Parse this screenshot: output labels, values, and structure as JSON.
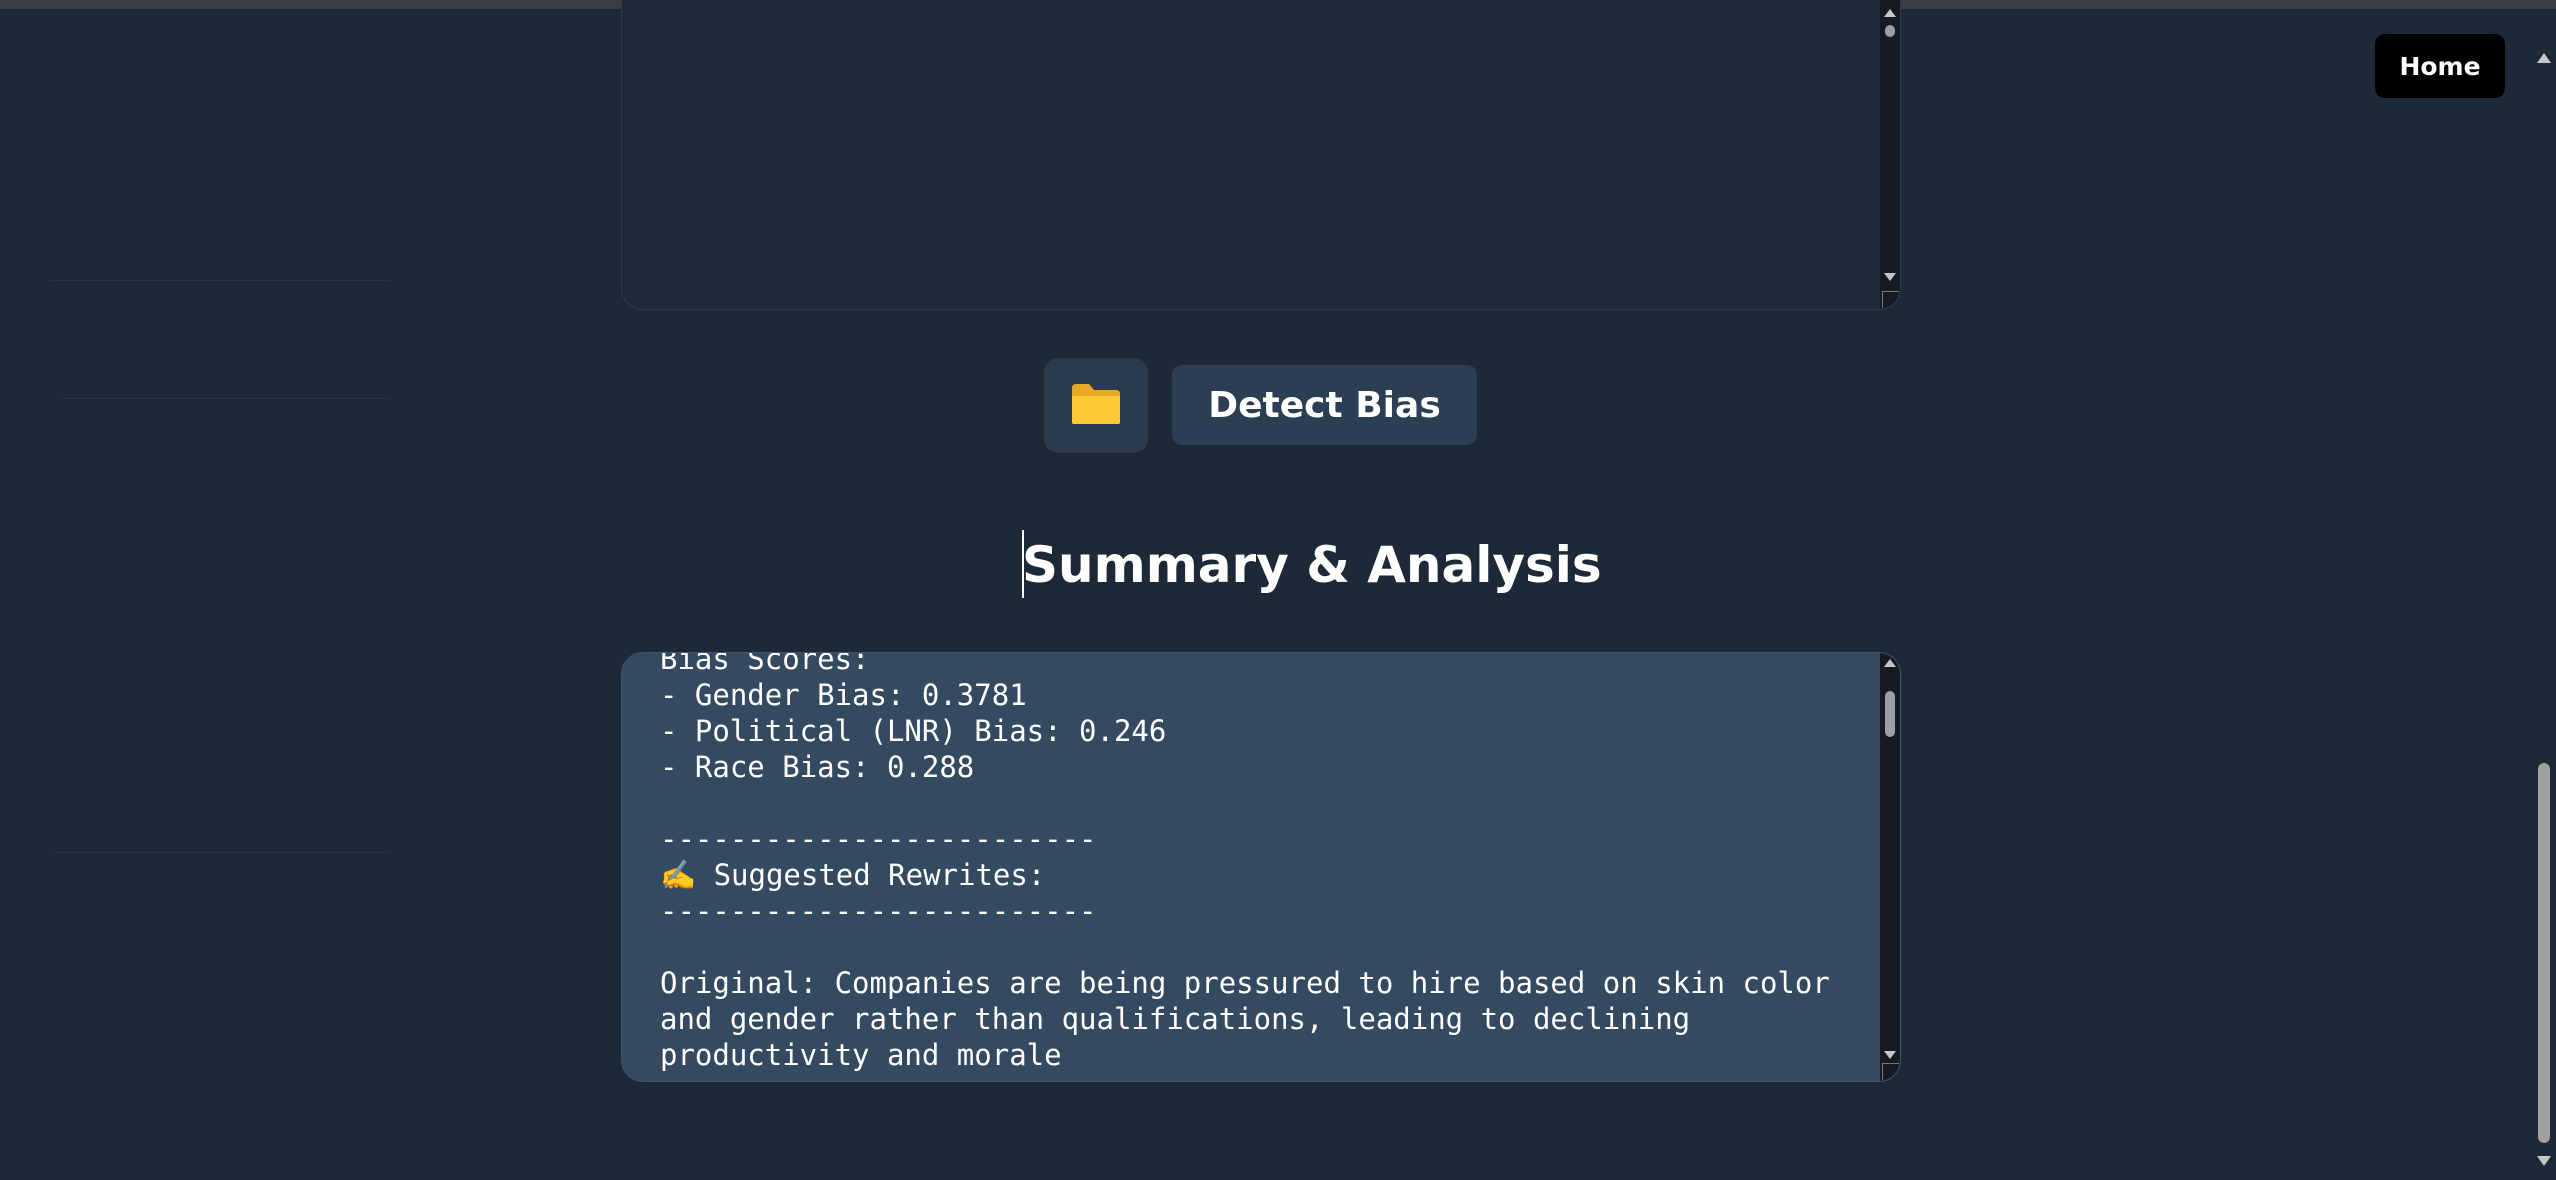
{
  "nav": {
    "home_label": "Home"
  },
  "input_panel": {
    "value": ""
  },
  "actions": {
    "folder_icon": "📁",
    "detect_label": "Detect Bias"
  },
  "summary": {
    "title": "Summary & Analysis",
    "lines": [
      "Bias Scores:",
      "- Gender Bias: 0.3781",
      "- Political (LNR) Bias: 0.246",
      "- Race Bias: 0.288",
      "",
      "-------------------------",
      "✍️ Suggested Rewrites:",
      "-------------------------",
      "",
      "Original: Companies are being pressured to hire based on skin color",
      "and gender rather than qualifications, leading to declining",
      "productivity and morale"
    ]
  },
  "colors": {
    "page_bg": "#1e2937",
    "output_bg": "#344a61",
    "button_bg": "#2c3e53",
    "home_bg": "#000000"
  }
}
